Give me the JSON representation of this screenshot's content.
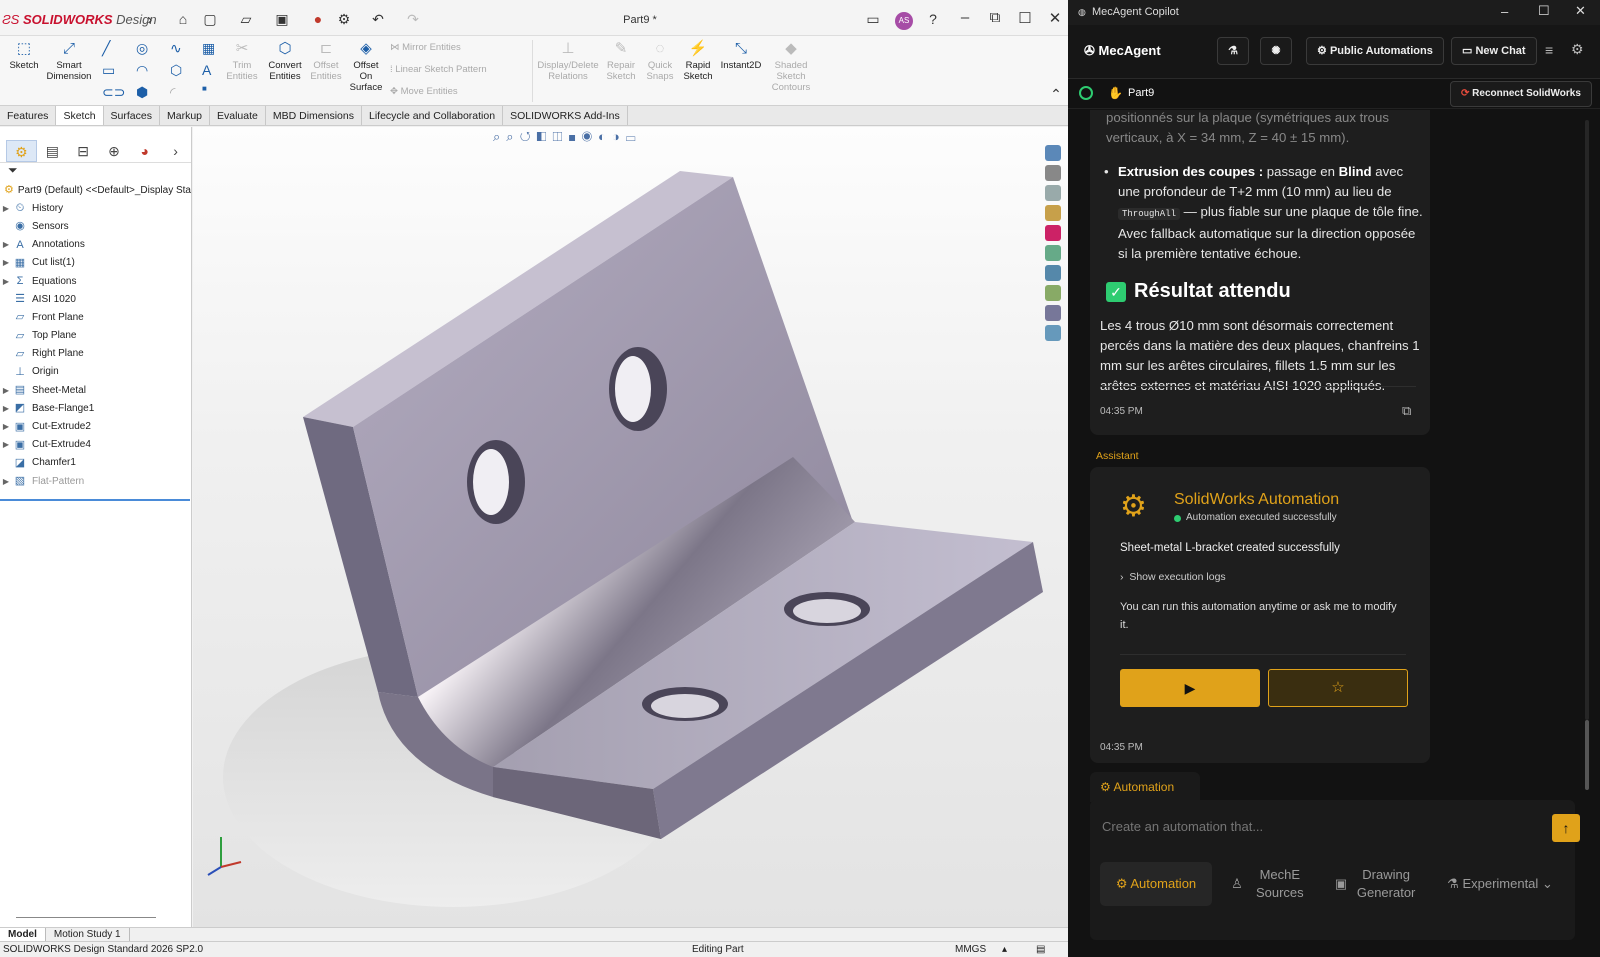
{
  "sw": {
    "app_brand": "SOLIDWORKS",
    "app_brand_suffix": "Design",
    "doc_title": "Part9 *",
    "user_initials": "AS",
    "commands": {
      "sketch": "Sketch",
      "smart_dimension": "Smart Dimension",
      "trim": "Trim Entities",
      "convert": "Convert Entities",
      "offset": "Offset Entities",
      "offset_surface": "Offset On Surface",
      "mirror": "Mirror Entities",
      "linear_pattern": "Linear Sketch Pattern",
      "move": "Move Entities",
      "display_delete": "Display/Delete Relations",
      "repair": "Repair Sketch",
      "quick_snaps": "Quick Snaps",
      "rapid_sketch": "Rapid Sketch",
      "instant2d": "Instant2D",
      "shaded_contours": "Shaded Sketch Contours"
    },
    "tabs": [
      "Features",
      "Sketch",
      "Surfaces",
      "Markup",
      "Evaluate",
      "MBD Dimensions",
      "Lifecycle and Collaboration",
      "SOLIDWORKS Add-Ins"
    ],
    "active_tab": "Sketch",
    "tree_root": "Part9 (Default) <<Default>_Display Sta",
    "tree": [
      {
        "label": "History",
        "expand": true,
        "icon": "history-icon",
        "dim": false
      },
      {
        "label": "Sensors",
        "expand": false,
        "icon": "sensors-icon",
        "dim": false
      },
      {
        "label": "Annotations",
        "expand": true,
        "icon": "annotations-icon",
        "dim": false
      },
      {
        "label": "Cut list(1)",
        "expand": true,
        "icon": "cutlist-icon",
        "dim": false
      },
      {
        "label": "Equations",
        "expand": true,
        "icon": "equations-icon",
        "dim": false
      },
      {
        "label": "AISI 1020",
        "expand": false,
        "icon": "material-icon",
        "dim": false
      },
      {
        "label": "Front Plane",
        "expand": false,
        "icon": "plane-icon",
        "dim": false
      },
      {
        "label": "Top Plane",
        "expand": false,
        "icon": "plane-icon",
        "dim": false
      },
      {
        "label": "Right Plane",
        "expand": false,
        "icon": "plane-icon",
        "dim": false
      },
      {
        "label": "Origin",
        "expand": false,
        "icon": "origin-icon",
        "dim": false
      },
      {
        "label": "Sheet-Metal",
        "expand": true,
        "icon": "sheetmetal-icon",
        "dim": false
      },
      {
        "label": "Base-Flange1",
        "expand": true,
        "icon": "flange-icon",
        "dim": false
      },
      {
        "label": "Cut-Extrude2",
        "expand": true,
        "icon": "cut-icon",
        "dim": false
      },
      {
        "label": "Cut-Extrude4",
        "expand": true,
        "icon": "cut-icon",
        "dim": false
      },
      {
        "label": "Chamfer1",
        "expand": false,
        "icon": "chamfer-icon",
        "dim": false
      },
      {
        "label": "Flat-Pattern",
        "expand": true,
        "icon": "flatpattern-icon",
        "dim": true
      }
    ],
    "bottom_tabs": [
      "Model",
      "Motion Study 1"
    ],
    "status_left": "SOLIDWORKS Design Standard 2026 SP2.0",
    "status_mid": "Editing Part",
    "status_units": "MMGS"
  },
  "copilot": {
    "window_title": "MecAgent Copilot",
    "brand": "MecAgent",
    "public_automations": "Public Automations",
    "new_chat": "New Chat",
    "part_name": "Part9",
    "reconnect": "Reconnect SolidWorks",
    "msg_top_partial": "positionnés sur la plaque (symétriques aux trous verticaux, à X = 34 mm, Z = 40 ± 15 mm).",
    "bullet_title": "Extrusion des coupes :",
    "bullet_text_1": " passage en ",
    "bullet_blind": "Blind",
    "bullet_text_2": " avec une profondeur de T+2 mm (10 mm) au lieu de ",
    "bullet_code": "ThroughAll",
    "bullet_text_3": " — plus fiable sur une plaque de tôle fine. Avec fallback automatique sur la direction opposée si la première tentative échoue.",
    "result_heading": "Résultat attendu",
    "result_text": "Les 4 trous Ø10 mm sont désormais correctement percés dans la matière des deux plaques, chanfreins 1 mm sur les arêtes circulaires, fillets 1.5 mm sur les arêtes externes et matériau AISI 1020 appliqués.",
    "time_1": "04:35 PM",
    "assistant_label": "Assistant",
    "card_title": "SolidWorks Automation",
    "card_status": "Automation executed successfully",
    "card_message": "Sheet-metal L-bracket created successfully",
    "show_logs": "Show execution logs",
    "card_hint": "You can run this automation anytime or ask me to modify it.",
    "time_2": "04:35 PM",
    "composer_tab": "Automation",
    "composer_placeholder": "Create an automation that...",
    "modes": [
      {
        "label": "Automation",
        "icon": "automation-icon"
      },
      {
        "label": "MechE Sources",
        "icon": "sources-icon"
      },
      {
        "label": "Drawing Generator",
        "icon": "drawing-icon"
      },
      {
        "label": "Experimental",
        "icon": "flask-icon"
      }
    ],
    "accent": "#e0a21a",
    "success": "#2ecc71"
  }
}
